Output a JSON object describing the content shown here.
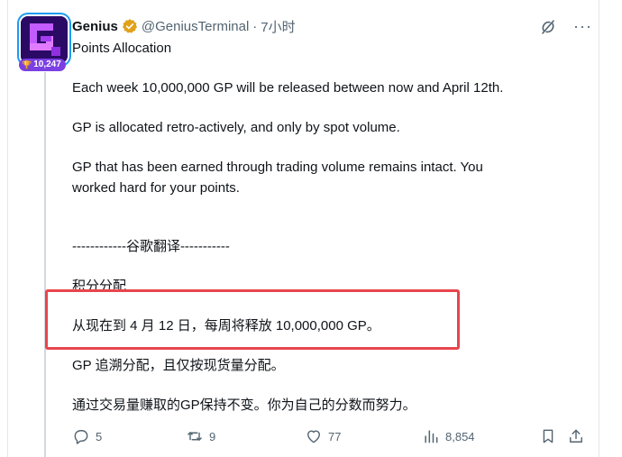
{
  "author": {
    "name": "Genius",
    "handle": "@GeniusTerminal",
    "separator": "·",
    "time": "7小时",
    "badge_count": "10,247",
    "verified_color": "#e0a21a"
  },
  "post": {
    "title": "Points Allocation",
    "paragraphs": [
      "Each week 10,000,000 GP will be released between now and April 12th.",
      "GP is allocated retro-actively, and only by spot volume.",
      "GP that has been earned through trading volume remains intact. You",
      "worked hard for your points.",
      "------------谷歌翻译-----------",
      "积分分配",
      "从现在到 4 月 12 日，每周将释放 10,000,000 GP。",
      "GP 追溯分配，且仅按现货量分配。",
      "通过交易量赚取的GP保持不变。你为自己的分数而努力。"
    ]
  },
  "actions": {
    "replies": "5",
    "reposts": "9",
    "likes": "77",
    "views": "8,854"
  },
  "colors": {
    "highlight": "#e8454d",
    "muted": "#536471",
    "badge": "#7b3fe4"
  }
}
